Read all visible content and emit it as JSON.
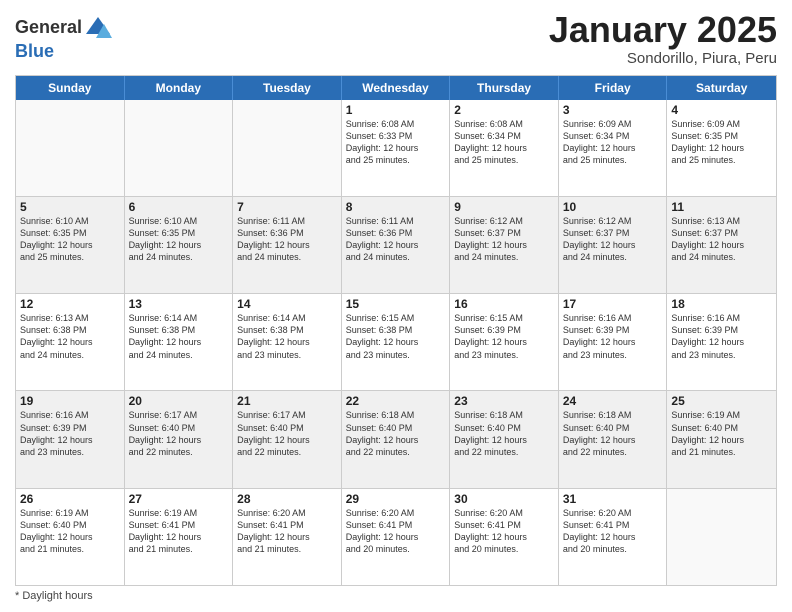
{
  "logo": {
    "general": "General",
    "blue": "Blue"
  },
  "header": {
    "month_title": "January 2025",
    "subtitle": "Sondorillo, Piura, Peru"
  },
  "weekdays": [
    "Sunday",
    "Monday",
    "Tuesday",
    "Wednesday",
    "Thursday",
    "Friday",
    "Saturday"
  ],
  "footer": {
    "daylight_label": "Daylight hours"
  },
  "weeks": [
    [
      {
        "day": "",
        "info": ""
      },
      {
        "day": "",
        "info": ""
      },
      {
        "day": "",
        "info": ""
      },
      {
        "day": "1",
        "info": "Sunrise: 6:08 AM\nSunset: 6:33 PM\nDaylight: 12 hours\nand 25 minutes."
      },
      {
        "day": "2",
        "info": "Sunrise: 6:08 AM\nSunset: 6:34 PM\nDaylight: 12 hours\nand 25 minutes."
      },
      {
        "day": "3",
        "info": "Sunrise: 6:09 AM\nSunset: 6:34 PM\nDaylight: 12 hours\nand 25 minutes."
      },
      {
        "day": "4",
        "info": "Sunrise: 6:09 AM\nSunset: 6:35 PM\nDaylight: 12 hours\nand 25 minutes."
      }
    ],
    [
      {
        "day": "5",
        "info": "Sunrise: 6:10 AM\nSunset: 6:35 PM\nDaylight: 12 hours\nand 25 minutes."
      },
      {
        "day": "6",
        "info": "Sunrise: 6:10 AM\nSunset: 6:35 PM\nDaylight: 12 hours\nand 24 minutes."
      },
      {
        "day": "7",
        "info": "Sunrise: 6:11 AM\nSunset: 6:36 PM\nDaylight: 12 hours\nand 24 minutes."
      },
      {
        "day": "8",
        "info": "Sunrise: 6:11 AM\nSunset: 6:36 PM\nDaylight: 12 hours\nand 24 minutes."
      },
      {
        "day": "9",
        "info": "Sunrise: 6:12 AM\nSunset: 6:37 PM\nDaylight: 12 hours\nand 24 minutes."
      },
      {
        "day": "10",
        "info": "Sunrise: 6:12 AM\nSunset: 6:37 PM\nDaylight: 12 hours\nand 24 minutes."
      },
      {
        "day": "11",
        "info": "Sunrise: 6:13 AM\nSunset: 6:37 PM\nDaylight: 12 hours\nand 24 minutes."
      }
    ],
    [
      {
        "day": "12",
        "info": "Sunrise: 6:13 AM\nSunset: 6:38 PM\nDaylight: 12 hours\nand 24 minutes."
      },
      {
        "day": "13",
        "info": "Sunrise: 6:14 AM\nSunset: 6:38 PM\nDaylight: 12 hours\nand 24 minutes."
      },
      {
        "day": "14",
        "info": "Sunrise: 6:14 AM\nSunset: 6:38 PM\nDaylight: 12 hours\nand 23 minutes."
      },
      {
        "day": "15",
        "info": "Sunrise: 6:15 AM\nSunset: 6:38 PM\nDaylight: 12 hours\nand 23 minutes."
      },
      {
        "day": "16",
        "info": "Sunrise: 6:15 AM\nSunset: 6:39 PM\nDaylight: 12 hours\nand 23 minutes."
      },
      {
        "day": "17",
        "info": "Sunrise: 6:16 AM\nSunset: 6:39 PM\nDaylight: 12 hours\nand 23 minutes."
      },
      {
        "day": "18",
        "info": "Sunrise: 6:16 AM\nSunset: 6:39 PM\nDaylight: 12 hours\nand 23 minutes."
      }
    ],
    [
      {
        "day": "19",
        "info": "Sunrise: 6:16 AM\nSunset: 6:39 PM\nDaylight: 12 hours\nand 23 minutes."
      },
      {
        "day": "20",
        "info": "Sunrise: 6:17 AM\nSunset: 6:40 PM\nDaylight: 12 hours\nand 22 minutes."
      },
      {
        "day": "21",
        "info": "Sunrise: 6:17 AM\nSunset: 6:40 PM\nDaylight: 12 hours\nand 22 minutes."
      },
      {
        "day": "22",
        "info": "Sunrise: 6:18 AM\nSunset: 6:40 PM\nDaylight: 12 hours\nand 22 minutes."
      },
      {
        "day": "23",
        "info": "Sunrise: 6:18 AM\nSunset: 6:40 PM\nDaylight: 12 hours\nand 22 minutes."
      },
      {
        "day": "24",
        "info": "Sunrise: 6:18 AM\nSunset: 6:40 PM\nDaylight: 12 hours\nand 22 minutes."
      },
      {
        "day": "25",
        "info": "Sunrise: 6:19 AM\nSunset: 6:40 PM\nDaylight: 12 hours\nand 21 minutes."
      }
    ],
    [
      {
        "day": "26",
        "info": "Sunrise: 6:19 AM\nSunset: 6:40 PM\nDaylight: 12 hours\nand 21 minutes."
      },
      {
        "day": "27",
        "info": "Sunrise: 6:19 AM\nSunset: 6:41 PM\nDaylight: 12 hours\nand 21 minutes."
      },
      {
        "day": "28",
        "info": "Sunrise: 6:20 AM\nSunset: 6:41 PM\nDaylight: 12 hours\nand 21 minutes."
      },
      {
        "day": "29",
        "info": "Sunrise: 6:20 AM\nSunset: 6:41 PM\nDaylight: 12 hours\nand 20 minutes."
      },
      {
        "day": "30",
        "info": "Sunrise: 6:20 AM\nSunset: 6:41 PM\nDaylight: 12 hours\nand 20 minutes."
      },
      {
        "day": "31",
        "info": "Sunrise: 6:20 AM\nSunset: 6:41 PM\nDaylight: 12 hours\nand 20 minutes."
      },
      {
        "day": "",
        "info": ""
      }
    ]
  ]
}
